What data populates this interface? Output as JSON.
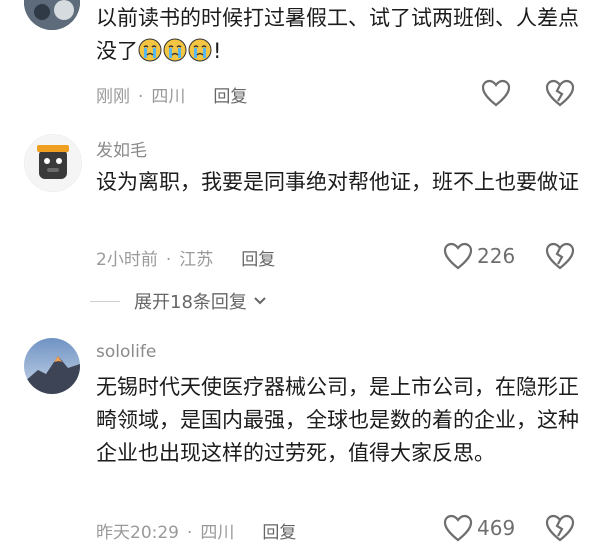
{
  "comments": [
    {
      "username": "",
      "text_pre": "以前读书的时候打过暑假工、试了试两班倒、人差点没了",
      "text_post": "!",
      "emoji_count": 3,
      "time": "刚刚",
      "location": "四川",
      "reply_label": "回复",
      "likes": ""
    },
    {
      "username": "发如毛",
      "text": "设为离职，我要是同事绝对帮他证，班不上也要做证",
      "time": "2小时前",
      "location": "江苏",
      "reply_label": "回复",
      "likes": "226"
    },
    {
      "username": "sololife",
      "text": "无锡时代天使医疗器械公司，是上市公司，在隐形正畸领域，是国内最强，全球也是数的着的企业，这种企业也出现这样的过劳死，值得大家反思。",
      "time": "昨天20:29",
      "location": "四川",
      "reply_label": "回复",
      "likes": "469"
    }
  ],
  "expand_replies": "展开18条回复",
  "separator": "·",
  "icons": {
    "like": "heart-outline-icon",
    "dislike": "broken-heart-icon",
    "expand": "chevron-down-icon"
  },
  "colors": {
    "meta": "#9a9a9a",
    "text": "#1c1c1c",
    "icon": "#6e6e6e"
  }
}
